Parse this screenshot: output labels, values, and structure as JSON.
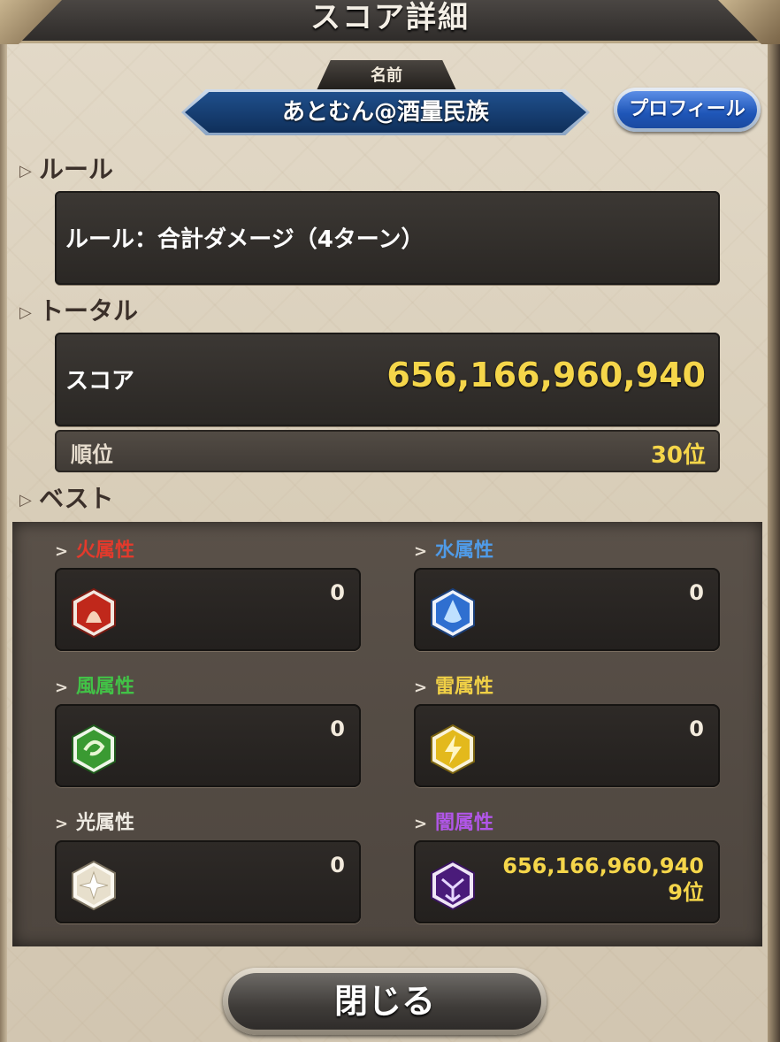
{
  "title": "スコア詳細",
  "name_tag": "名前",
  "player_name": "あとむん@酒量民族",
  "profile_button": "プロフィール",
  "sections": {
    "rule": "ルール",
    "total": "トータル",
    "best": "ベスト"
  },
  "rule_text": "ルール：合計ダメージ（4ターン）",
  "score": {
    "label": "スコア",
    "value": "656,166,960,940"
  },
  "rank": {
    "label": "順位",
    "value": "30位"
  },
  "elements": [
    {
      "label": "火属性",
      "value": "0",
      "color": "#e23a2c",
      "icon": "fire-icon"
    },
    {
      "label": "水属性",
      "value": "0",
      "color": "#4f9be8",
      "icon": "water-icon"
    },
    {
      "label": "風属性",
      "value": "0",
      "color": "#42c247",
      "icon": "wind-icon"
    },
    {
      "label": "雷属性",
      "value": "0",
      "color": "#f0d046",
      "icon": "thunder-icon"
    },
    {
      "label": "光属性",
      "value": "0",
      "color": "#eeeae2",
      "icon": "light-icon"
    },
    {
      "label": "闇属性",
      "value": "656,166,960,940",
      "rank": "9位",
      "color": "#b156e8",
      "icon": "dark-icon"
    }
  ],
  "close_button": "閉じる"
}
